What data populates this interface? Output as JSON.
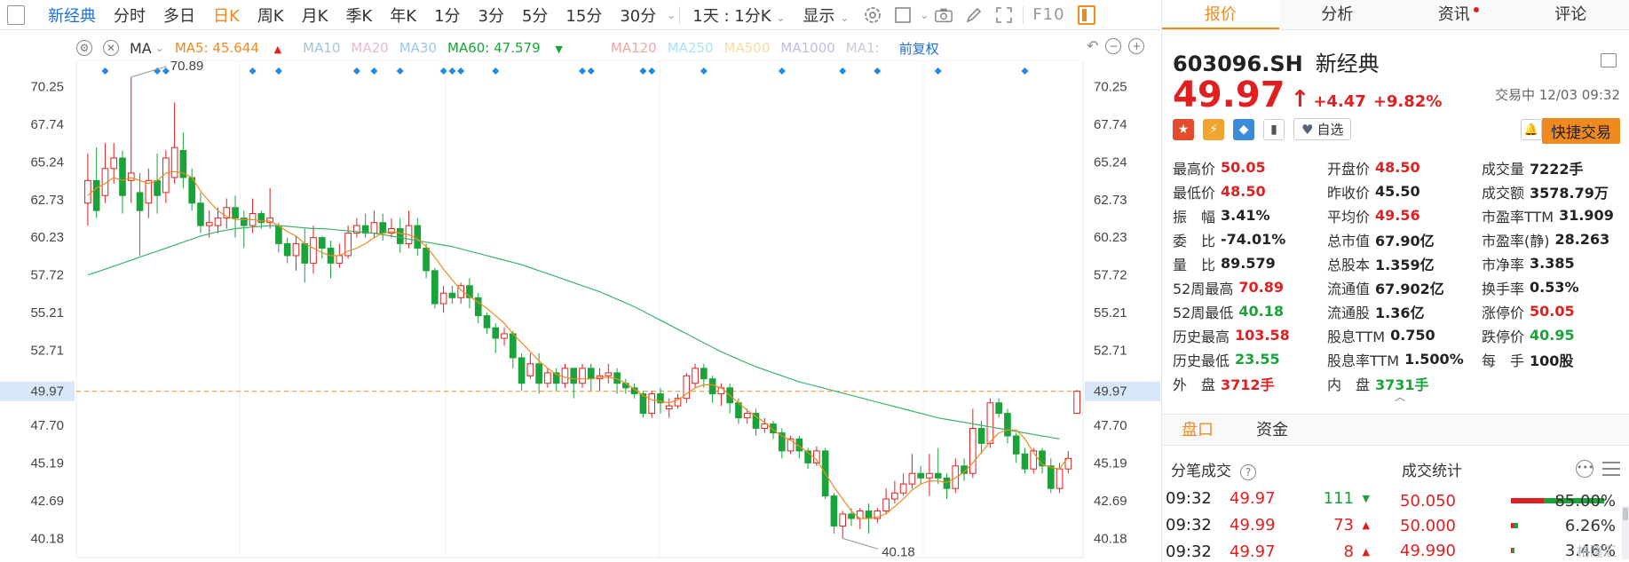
{
  "toolbar": {
    "items": [
      "新经典",
      "分时",
      "多日",
      "日K",
      "周K",
      "月K",
      "季K",
      "年K",
      "1分",
      "3分",
      "5分",
      "15分",
      "30分"
    ],
    "period_select": "1天 : 1分K",
    "display_label": "显示",
    "f10_label": "F10",
    "colors": {
      "active": "#1e6fd9",
      "orange": "#f08a1f"
    }
  },
  "ma_bar": {
    "ma_label": "MA",
    "ma5": "MA5: 45.644",
    "ma10": "MA10",
    "ma20": "MA20",
    "ma30": "MA30",
    "ma60": "MA60: 47.579",
    "ma120": "MA120",
    "ma250": "MA250",
    "ma500": "MA500",
    "ma1000": "MA1000",
    "ma1": "MA1:",
    "fq_label": "前复权"
  },
  "chart_data": {
    "type": "candlestick",
    "y_ticks": [
      "70.25",
      "67.74",
      "65.24",
      "62.73",
      "60.23",
      "57.72",
      "55.21",
      "52.71",
      "49.97",
      "47.70",
      "45.19",
      "42.69",
      "40.18"
    ],
    "ylim": [
      38.9,
      72.0
    ],
    "current_price": 49.97,
    "high_label": "70.89",
    "low_label": "40.18",
    "candles": [
      [
        62.5,
        64.0,
        61.0,
        65.8
      ],
      [
        64.0,
        62.0,
        61.5,
        66.2
      ],
      [
        63.0,
        64.8,
        62.5,
        66.5
      ],
      [
        64.8,
        65.5,
        63.8,
        66.5
      ],
      [
        65.5,
        63.0,
        61.8,
        66.0
      ],
      [
        64.0,
        64.5,
        62.5,
        70.89
      ],
      [
        63.2,
        62.0,
        59.0,
        64.5
      ],
      [
        62.5,
        64.0,
        61.5,
        64.8
      ],
      [
        64.0,
        63.0,
        61.8,
        65.8
      ],
      [
        63.2,
        65.5,
        62.5,
        66.0
      ],
      [
        64.2,
        66.2,
        63.8,
        69.2
      ],
      [
        66.0,
        64.2,
        63.5,
        67.2
      ],
      [
        64.2,
        62.5,
        62.0,
        64.8
      ],
      [
        62.5,
        61.0,
        60.5,
        63.2
      ],
      [
        61.0,
        61.2,
        60.2,
        62.0
      ],
      [
        61.0,
        61.5,
        60.5,
        62.2
      ],
      [
        61.5,
        62.2,
        60.8,
        62.8
      ],
      [
        62.2,
        61.5,
        60.2,
        63.0
      ],
      [
        61.5,
        61.0,
        59.5,
        62.0
      ],
      [
        61.0,
        61.8,
        60.5,
        62.8
      ],
      [
        61.8,
        61.2,
        60.8,
        62.0
      ],
      [
        61.2,
        61.5,
        60.8,
        63.5
      ],
      [
        61.0,
        59.8,
        59.2,
        61.2
      ],
      [
        59.8,
        59.0,
        58.5,
        60.2
      ],
      [
        59.0,
        59.8,
        58.0,
        60.3
      ],
      [
        59.8,
        58.5,
        57.2,
        60.8
      ],
      [
        58.5,
        60.2,
        57.8,
        61.0
      ],
      [
        60.2,
        59.5,
        58.8,
        60.3
      ],
      [
        59.5,
        58.5,
        57.5,
        60.0
      ],
      [
        58.5,
        59.0,
        58.2,
        59.8
      ],
      [
        59.0,
        60.5,
        58.8,
        61.0
      ],
      [
        60.5,
        61.0,
        60.2,
        61.5
      ],
      [
        61.0,
        60.5,
        60.2,
        61.8
      ],
      [
        60.5,
        61.2,
        60.2,
        62.0
      ],
      [
        61.2,
        60.5,
        60.0,
        61.8
      ],
      [
        60.5,
        60.8,
        60.2,
        61.5
      ],
      [
        60.8,
        59.8,
        59.2,
        61.5
      ],
      [
        59.8,
        61.0,
        59.5,
        62.0
      ],
      [
        61.0,
        59.5,
        59.0,
        61.5
      ],
      [
        59.5,
        58.0,
        57.5,
        59.8
      ],
      [
        58.0,
        55.8,
        55.5,
        58.2
      ],
      [
        55.8,
        56.5,
        55.2,
        57.0
      ],
      [
        56.5,
        56.2,
        55.8,
        57.0
      ],
      [
        56.2,
        57.0,
        55.8,
        57.2
      ],
      [
        57.0,
        56.2,
        55.5,
        57.5
      ],
      [
        56.2,
        55.0,
        54.5,
        56.5
      ],
      [
        55.0,
        54.2,
        53.8,
        55.2
      ],
      [
        54.2,
        53.5,
        52.5,
        54.5
      ],
      [
        53.5,
        53.8,
        53.0,
        54.2
      ],
      [
        53.8,
        52.2,
        51.5,
        54.0
      ],
      [
        52.2,
        50.5,
        50.0,
        52.5
      ],
      [
        51.0,
        51.8,
        50.8,
        52.5
      ],
      [
        51.8,
        50.5,
        49.8,
        52.5
      ],
      [
        50.5,
        51.2,
        50.2,
        51.5
      ],
      [
        51.2,
        50.5,
        50.0,
        51.5
      ],
      [
        50.5,
        51.5,
        50.2,
        51.8
      ],
      [
        51.5,
        50.5,
        49.5,
        51.5
      ],
      [
        50.5,
        51.5,
        50.2,
        51.8
      ],
      [
        51.5,
        50.8,
        50.0,
        51.8
      ],
      [
        50.8,
        51.0,
        50.0,
        51.5
      ],
      [
        51.0,
        51.2,
        50.5,
        51.8
      ],
      [
        51.2,
        50.5,
        49.8,
        51.5
      ],
      [
        50.5,
        50.2,
        49.8,
        50.8
      ],
      [
        50.2,
        49.8,
        49.5,
        50.5
      ],
      [
        49.8,
        48.5,
        48.2,
        50.0
      ],
      [
        48.5,
        49.8,
        48.2,
        50.0
      ],
      [
        49.8,
        49.2,
        48.5,
        50.2
      ],
      [
        48.8,
        49.0,
        48.2,
        49.5
      ],
      [
        49.0,
        49.5,
        48.8,
        49.8
      ],
      [
        49.5,
        51.0,
        49.2,
        51.2
      ],
      [
        50.5,
        51.5,
        50.2,
        51.8
      ],
      [
        51.5,
        50.8,
        50.2,
        51.8
      ],
      [
        50.8,
        49.8,
        49.2,
        51.0
      ],
      [
        49.8,
        50.2,
        49.0,
        50.5
      ],
      [
        50.2,
        49.2,
        48.5,
        50.5
      ],
      [
        49.2,
        48.2,
        47.8,
        49.5
      ],
      [
        48.2,
        48.5,
        47.8,
        48.8
      ],
      [
        48.5,
        47.5,
        47.0,
        48.8
      ],
      [
        47.5,
        47.8,
        47.2,
        48.2
      ],
      [
        47.8,
        47.2,
        46.8,
        48.0
      ],
      [
        47.2,
        46.0,
        45.5,
        47.5
      ],
      [
        46.0,
        46.8,
        45.8,
        47.0
      ],
      [
        46.8,
        46.0,
        45.5,
        47.0
      ],
      [
        46.0,
        45.2,
        44.8,
        46.2
      ],
      [
        45.2,
        46.0,
        45.0,
        46.3
      ],
      [
        46.0,
        43.0,
        42.8,
        46.2
      ],
      [
        43.0,
        41.0,
        40.5,
        43.2
      ],
      [
        41.0,
        41.8,
        40.18,
        42.0
      ],
      [
        41.8,
        41.5,
        41.0,
        42.2
      ],
      [
        41.5,
        42.0,
        40.8,
        42.2
      ],
      [
        42.0,
        41.5,
        40.5,
        42.5
      ],
      [
        41.5,
        42.0,
        41.2,
        42.2
      ],
      [
        42.0,
        42.8,
        41.8,
        43.5
      ],
      [
        42.8,
        43.2,
        42.5,
        44.0
      ],
      [
        43.2,
        43.8,
        43.0,
        44.5
      ],
      [
        43.8,
        44.5,
        43.5,
        45.8
      ],
      [
        44.5,
        44.2,
        43.8,
        45.0
      ],
      [
        44.2,
        44.5,
        43.0,
        45.8
      ],
      [
        44.5,
        44.2,
        43.8,
        46.2
      ],
      [
        44.2,
        43.5,
        42.8,
        44.5
      ],
      [
        43.5,
        45.0,
        43.2,
        45.5
      ],
      [
        45.0,
        44.5,
        44.0,
        45.5
      ],
      [
        44.5,
        47.5,
        44.2,
        48.8
      ],
      [
        47.5,
        46.5,
        45.8,
        48.0
      ],
      [
        46.5,
        49.2,
        46.2,
        49.5
      ],
      [
        49.2,
        48.5,
        48.2,
        49.5
      ],
      [
        48.5,
        47.0,
        46.5,
        48.8
      ],
      [
        47.0,
        45.8,
        45.2,
        47.2
      ],
      [
        45.8,
        44.8,
        44.5,
        46.2
      ],
      [
        44.8,
        46.0,
        44.5,
        46.2
      ],
      [
        46.0,
        45.0,
        44.5,
        46.2
      ],
      [
        45.0,
        43.5,
        43.2,
        45.5
      ],
      [
        43.5,
        44.8,
        43.2,
        45.2
      ],
      [
        44.8,
        45.5,
        44.5,
        46.0
      ],
      [
        48.5,
        49.97,
        48.5,
        50.05
      ]
    ],
    "ma5": [
      63.0,
      63.5,
      63.8,
      64.2,
      64.0,
      64.2,
      64.0,
      63.8,
      64.0,
      64.5,
      64.6,
      64.5,
      64.2,
      63.3,
      62.6,
      62.0,
      61.6,
      61.4,
      61.4,
      61.4,
      61.3,
      61.3,
      61.0,
      60.6,
      60.3,
      59.8,
      59.5,
      59.2,
      59.0,
      59.0,
      59.3,
      59.5,
      59.8,
      60.2,
      60.5,
      60.6,
      60.5,
      60.4,
      60.1,
      59.6,
      58.9,
      58.1,
      57.4,
      56.7,
      56.3,
      55.9,
      55.5,
      55.0,
      54.5,
      53.8,
      53.2,
      52.6,
      52.0,
      51.5,
      51.1,
      50.9,
      50.8,
      50.8,
      50.8,
      50.9,
      50.9,
      50.8,
      50.5,
      50.1,
      49.7,
      49.4,
      49.3,
      49.2,
      49.4,
      49.8,
      50.2,
      50.4,
      50.4,
      50.2,
      49.7,
      49.2,
      48.7,
      48.3,
      47.9,
      47.4,
      47.0,
      46.7,
      46.3,
      45.9,
      45.4,
      44.5,
      43.6,
      42.8,
      42.0,
      41.5,
      41.5,
      41.6,
      41.8,
      42.3,
      42.8,
      43.4,
      43.8,
      44.0,
      44.0,
      43.9,
      44.2,
      44.6,
      45.2,
      45.9,
      46.6,
      47.2,
      47.4,
      47.4,
      46.8,
      45.9,
      45.1,
      44.9,
      44.8,
      45.6
    ],
    "ma60": [
      57.72,
      57.9,
      58.1,
      58.3,
      58.5,
      58.7,
      58.9,
      59.1,
      59.3,
      59.5,
      59.7,
      59.9,
      60.1,
      60.3,
      60.45,
      60.6,
      60.7,
      60.8,
      60.85,
      60.9,
      60.95,
      61.0,
      61.0,
      60.95,
      60.9,
      60.85,
      60.8,
      60.8,
      60.75,
      60.7,
      60.65,
      60.6,
      60.55,
      60.5,
      60.4,
      60.3,
      60.2,
      60.1,
      60.0,
      59.9,
      59.8,
      59.7,
      59.6,
      59.45,
      59.3,
      59.15,
      59.0,
      58.85,
      58.7,
      58.55,
      58.4,
      58.2,
      58.0,
      57.8,
      57.6,
      57.4,
      57.2,
      57.0,
      56.8,
      56.6,
      56.35,
      56.1,
      55.85,
      55.6,
      55.3,
      55.0,
      54.7,
      54.4,
      54.1,
      53.8,
      53.5,
      53.2,
      52.9,
      52.6,
      52.35,
      52.1,
      51.85,
      51.6,
      51.4,
      51.2,
      51.0,
      50.8,
      50.6,
      50.45,
      50.3,
      50.15,
      50.0,
      49.85,
      49.7,
      49.55,
      49.4,
      49.25,
      49.1,
      48.95,
      48.8,
      48.65,
      48.5,
      48.35,
      48.2,
      48.1,
      48.0,
      47.9,
      47.8,
      47.7,
      47.6,
      47.5,
      47.4,
      47.3,
      47.2,
      47.1,
      47.0,
      46.9,
      46.8
    ]
  },
  "quote": {
    "code": "603096.SH",
    "name": "新经典",
    "price": "49.97",
    "change": "+4.47",
    "change_pct": "+9.82%",
    "status": "交易中 12/03 09:32",
    "watch_label": "自选",
    "quick_trade": "快捷交易"
  },
  "panel_tabs": [
    "报价",
    "分析",
    "资讯",
    "评论"
  ],
  "stats": [
    {
      "label": "最高价",
      "value": "50.05",
      "color": "red"
    },
    {
      "label": "开盘价",
      "value": "48.50",
      "color": "red"
    },
    {
      "label": "成交量",
      "value": "7222手",
      "color": ""
    },
    {
      "label": "最低价",
      "value": "48.50",
      "color": "red"
    },
    {
      "label": "昨收价",
      "value": "45.50",
      "color": ""
    },
    {
      "label": "成交额",
      "value": "3578.79万",
      "color": ""
    },
    {
      "label": "振　幅",
      "value": "3.41%",
      "color": ""
    },
    {
      "label": "平均价",
      "value": "49.56",
      "color": "red"
    },
    {
      "label": "市盈率TTM",
      "value": "31.909",
      "color": ""
    },
    {
      "label": "委　比",
      "value": "-74.01%",
      "color": ""
    },
    {
      "label": "总市值",
      "value": "67.90亿",
      "color": ""
    },
    {
      "label": "市盈率(静)",
      "value": "28.263",
      "color": ""
    },
    {
      "label": "量　比",
      "value": "89.579",
      "color": ""
    },
    {
      "label": "总股本",
      "value": "1.359亿",
      "color": ""
    },
    {
      "label": "市净率",
      "value": "3.385",
      "color": ""
    },
    {
      "label": "52周最高",
      "value": "70.89",
      "color": "red"
    },
    {
      "label": "流通值",
      "value": "67.902亿",
      "color": ""
    },
    {
      "label": "换手率",
      "value": "0.53%",
      "color": ""
    },
    {
      "label": "52周最低",
      "value": "40.18",
      "color": "green"
    },
    {
      "label": "流通股",
      "value": "1.36亿",
      "color": ""
    },
    {
      "label": "涨停价",
      "value": "50.05",
      "color": "red"
    },
    {
      "label": "历史最高",
      "value": "103.58",
      "color": "red"
    },
    {
      "label": "股息TTM",
      "value": "0.750",
      "color": ""
    },
    {
      "label": "跌停价",
      "value": "40.95",
      "color": "green"
    },
    {
      "label": "历史最低",
      "value": "23.55",
      "color": "green"
    },
    {
      "label": "股息率TTM",
      "value": "1.500%",
      "color": ""
    },
    {
      "label": "每　手",
      "value": "100股",
      "color": ""
    },
    {
      "label": "外　盘",
      "value": "3712手",
      "color": "red"
    },
    {
      "label": "内　盘",
      "value": "3731手",
      "color": "green"
    }
  ],
  "subtabs": [
    "盘口",
    "资金"
  ],
  "ticks_title": "分笔成交",
  "ticks": [
    {
      "time": "09:32",
      "price": "49.97",
      "vol": "111",
      "dir": "down"
    },
    {
      "time": "09:32",
      "price": "49.99",
      "vol": "73",
      "dir": "up"
    },
    {
      "time": "09:32",
      "price": "49.97",
      "vol": "8",
      "dir": "up"
    }
  ],
  "vstats_title": "成交统计",
  "vstats": [
    {
      "price": "50.050",
      "pct": "85.00%",
      "share": 0.85
    },
    {
      "price": "50.000",
      "pct": "6.26%",
      "share": 0.063
    },
    {
      "price": "49.990",
      "pct": "3.46%",
      "share": 0.035
    }
  ],
  "watermark": "格隆汇"
}
